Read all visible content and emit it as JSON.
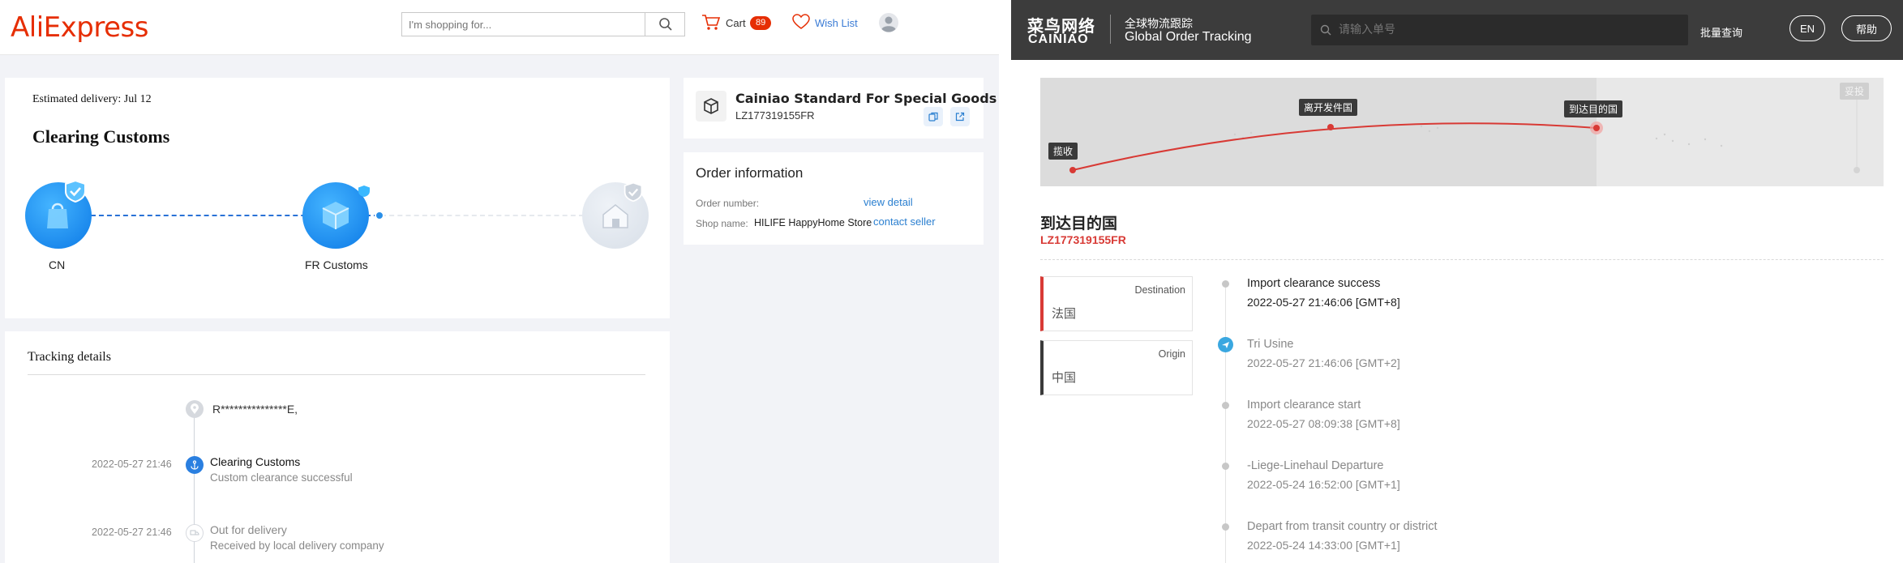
{
  "aliexpress": {
    "logo": "AliExpress",
    "search": {
      "placeholder": "I'm shopping for..."
    },
    "cart": {
      "label": "Cart",
      "count": "89"
    },
    "wishlist": {
      "label": "Wish List"
    },
    "progress": {
      "estimated": "Estimated delivery: Jul 12",
      "status": "Clearing Customs",
      "nodes": [
        {
          "label": "CN"
        },
        {
          "label": "FR Customs"
        },
        {
          "label": ""
        }
      ]
    },
    "tracking": {
      "title": "Tracking details",
      "address": "R***************E,",
      "events": [
        {
          "time": "2022-05-27 21:46",
          "title": "Clearing Customs",
          "desc": "Custom clearance successful"
        },
        {
          "time": "2022-05-27 21:46",
          "title": "Out for delivery",
          "desc": "Received by local delivery company"
        }
      ]
    },
    "carrier": {
      "name": "Cainiao Standard For Special Goods",
      "tracking_no": "LZ177319155FR"
    },
    "order_info": {
      "title": "Order information",
      "order_number_label": "Order number:",
      "view_detail": "view detail",
      "shop_name_label": "Shop name:",
      "shop_name": "HILIFE HappyHome Store",
      "contact_seller": "contact seller"
    }
  },
  "cainiao": {
    "logo_cn": "菜鸟网络",
    "logo_en": "CAINIAO",
    "title_cn": "全球物流跟踪",
    "title_en": "Global Order Tracking",
    "search": {
      "placeholder": "请输入单号"
    },
    "batch": "批量查询",
    "lang": "EN",
    "help": "帮助",
    "map_tags": {
      "pickup": "揽收",
      "departed": "离开发件国",
      "arrived": "到达目的国",
      "delivered": "妥投"
    },
    "status": "到达目的国",
    "tracking_no": "LZ177319155FR",
    "destination": {
      "role": "Destination",
      "place": "法国"
    },
    "origin": {
      "role": "Origin",
      "place": "中国"
    },
    "events": [
      {
        "title": "Import clearance success",
        "time": "2022-05-27 21:46:06 [GMT+8]"
      },
      {
        "title": "Tri Usine",
        "time": "2022-05-27 21:46:06 [GMT+2]"
      },
      {
        "title": "Import clearance start",
        "time": "2022-05-27 08:09:38 [GMT+8]"
      },
      {
        "title": "-Liege-Linehaul Departure",
        "time": "2022-05-24 16:52:00 [GMT+1]"
      },
      {
        "title": "Depart from transit country or district",
        "time": "2022-05-24 14:33:00 [GMT+1]"
      }
    ]
  },
  "colors": {
    "ali_red": "#e62e04",
    "ali_blue": "#0c79e6",
    "link_blue": "#2a7fd0",
    "cainiao_header": "#3c3c3c",
    "cainiao_red": "#d83a35"
  }
}
